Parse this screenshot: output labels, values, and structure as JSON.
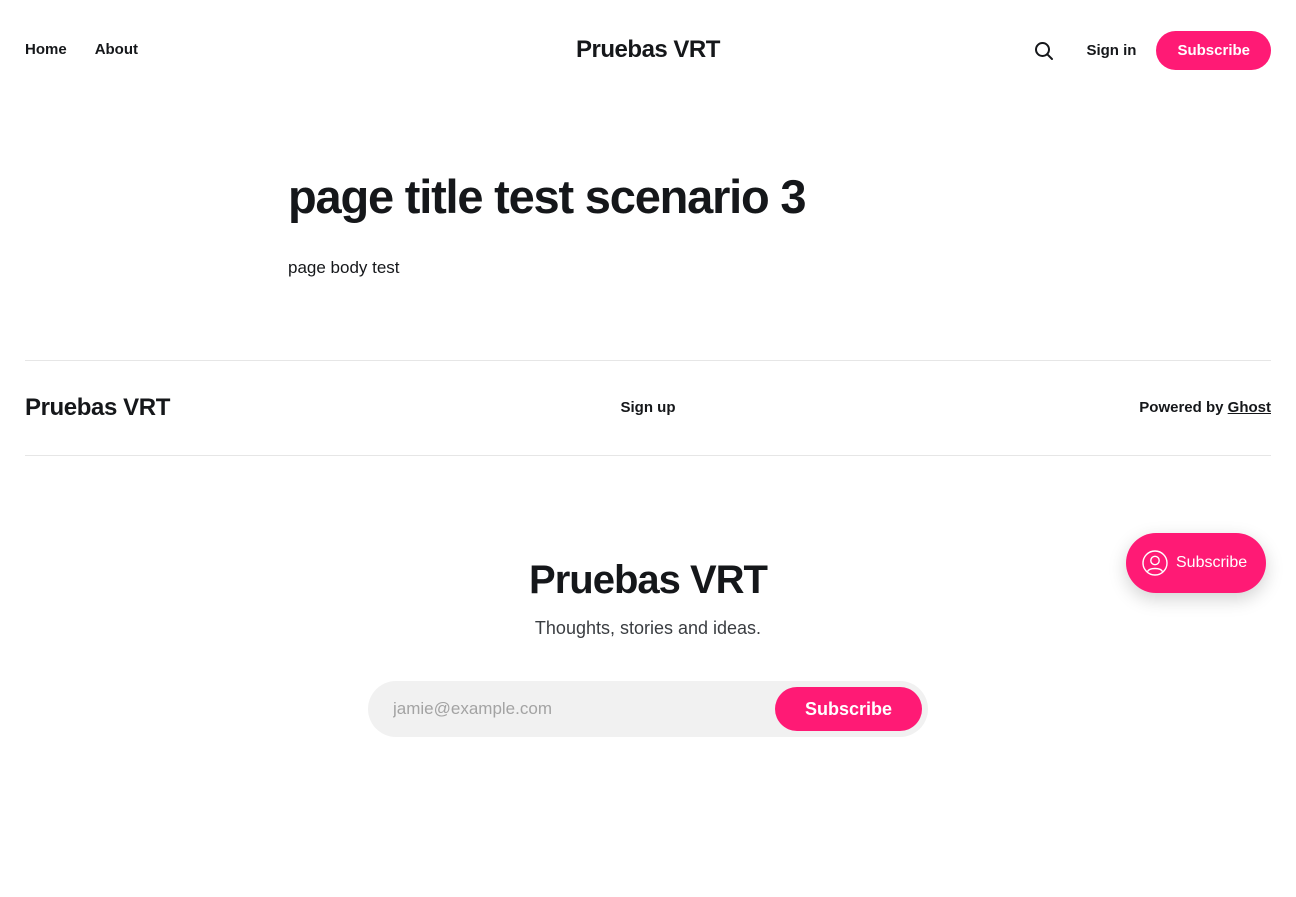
{
  "header": {
    "nav": [
      {
        "label": "Home"
      },
      {
        "label": "About"
      }
    ],
    "site_title": "Pruebas VRT",
    "search_icon": "search-icon",
    "signin_label": "Sign in",
    "subscribe_label": "Subscribe"
  },
  "article": {
    "title": "page title test scenario 3",
    "body": "page body test"
  },
  "footer": {
    "site_title": "Pruebas VRT",
    "signup_label": "Sign up",
    "powered_prefix": "Powered by",
    "powered_link": "Ghost"
  },
  "cta": {
    "title": "Pruebas VRT",
    "description": "Thoughts, stories and ideas.",
    "email_placeholder": "jamie@example.com",
    "button_label": "Subscribe"
  },
  "portal": {
    "icon": "user-circle-icon",
    "label": "Subscribe"
  },
  "colors": {
    "accent": "#ff1a75",
    "text": "#15171a",
    "input_bg": "#f1f1f1"
  }
}
